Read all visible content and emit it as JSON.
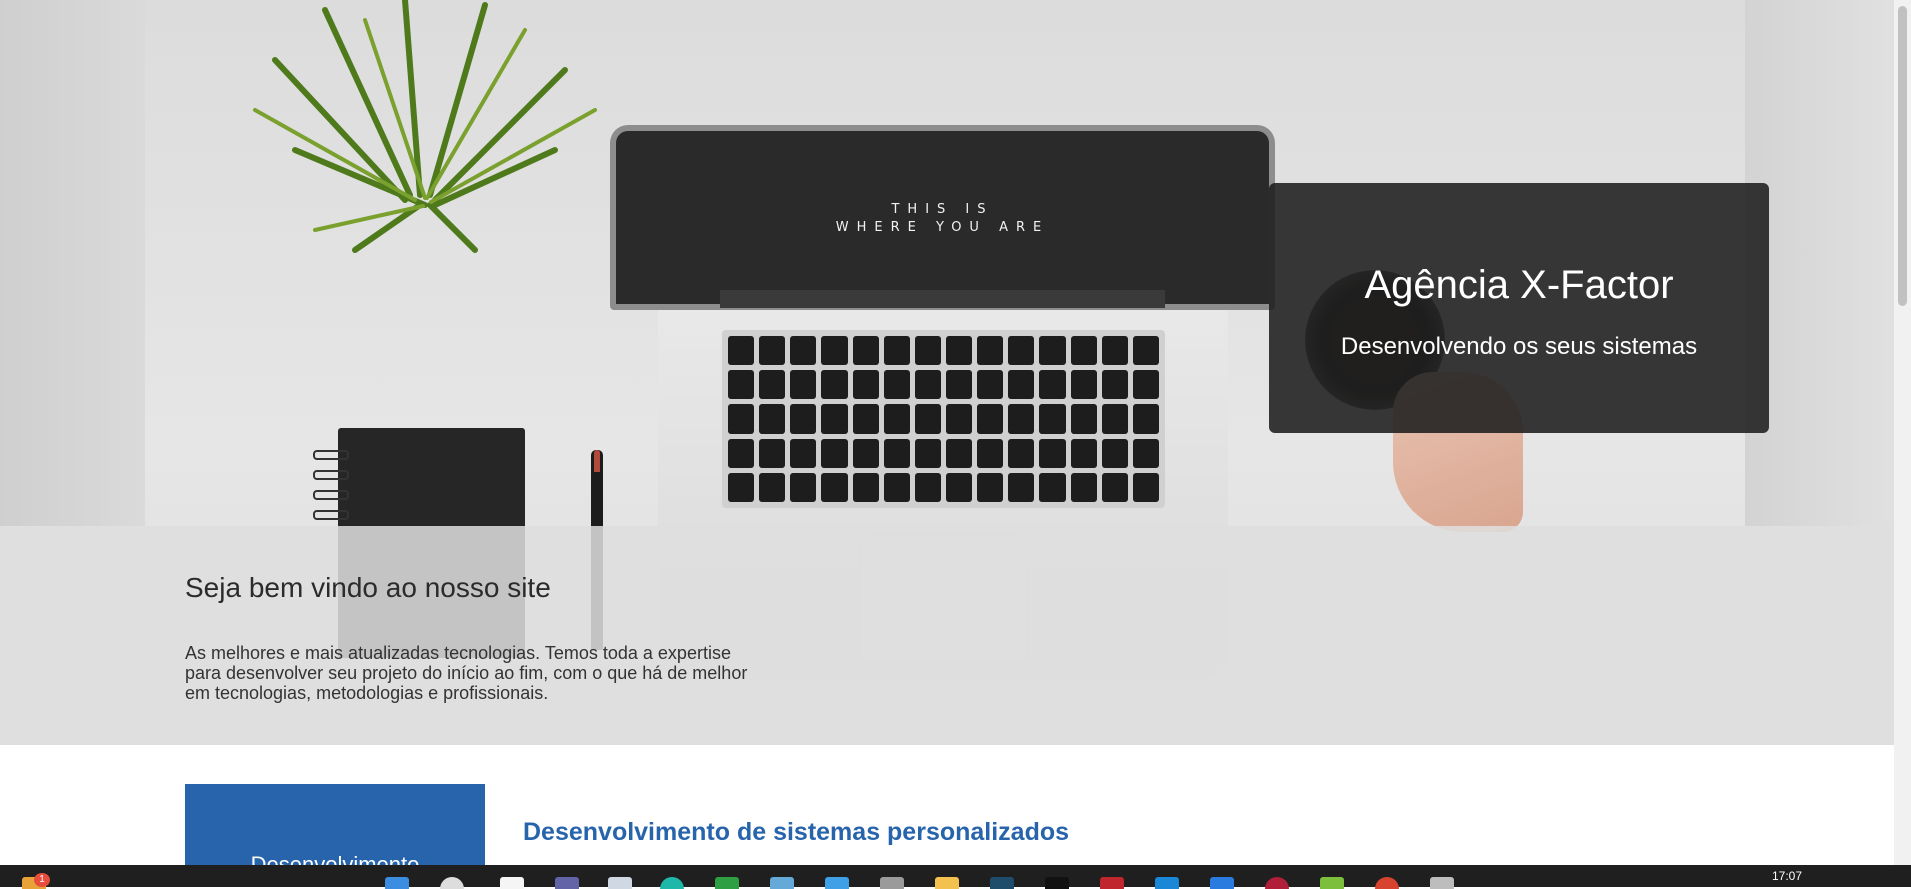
{
  "hero": {
    "laptop_screen_line1": "THIS IS",
    "laptop_screen_line2": "WHERE YOU ARE"
  },
  "brand": {
    "title": "Agência X-Factor",
    "subtitle": "Desenvolvendo os seus sistemas"
  },
  "welcome": {
    "title": "Seja bem vindo ao nosso site",
    "text_line1": "As melhores e mais atualizadas tecnologias. Temos toda a expertise",
    "text_line2": "para desenvolver seu projeto do início ao fim, com o que há de melhor",
    "text_line3": "em tecnologias, metodologias e profissionais."
  },
  "services": {
    "box_label": "Desenvolvimento",
    "heading": "Desenvolvimento de sistemas personalizados"
  },
  "taskbar": {
    "badge_count": "1",
    "clock": "17:07",
    "icons": [
      "start-icon",
      "search-icon",
      "file-icon",
      "teams-icon",
      "notepad-icon",
      "edge-icon",
      "terminal-icon",
      "monitor-icon",
      "photos-icon",
      "settings-icon",
      "folder-icon",
      "app-icon",
      "app-icon",
      "app-icon",
      "app-icon",
      "store-icon",
      "app-icon",
      "app-icon",
      "chrome-icon",
      "disk-icon"
    ],
    "colors": {
      "accent": "#2764ac",
      "bar": "#1f1f1f",
      "badge": "#e74c3c"
    }
  }
}
